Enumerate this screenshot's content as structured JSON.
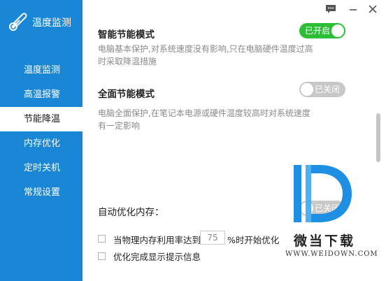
{
  "app": {
    "title": "温度监测"
  },
  "sidebar": {
    "items": [
      {
        "label": "温度监测"
      },
      {
        "label": "高温报警"
      },
      {
        "label": "节能降温"
      },
      {
        "label": "内存优化"
      },
      {
        "label": "定时关机"
      },
      {
        "label": "常规设置"
      }
    ],
    "active_index": 2
  },
  "sections": {
    "smart": {
      "title": "智能节能模式",
      "desc_line1": "电脑基本保护,对系统速度没有影响,只在电脑硬件温度过高",
      "desc_line2": "时采取降温措施",
      "toggle_label": "已开启",
      "toggle_on": true
    },
    "full": {
      "title": "全面节能模式",
      "desc_line1": "电脑全面保护,在笔记本电源或硬件温度较高时对系统速度",
      "desc_line2": "有一定影响",
      "toggle_label": "已关闭",
      "toggle_on": false
    },
    "memory": {
      "title": "自动优化内存：",
      "toggle_label": "已关闭",
      "toggle_on": false,
      "option1_prefix": "当物理内存利用率达到",
      "option1_value": "75",
      "option1_suffix": "%时开始优化",
      "option2_label": "优化完成显示提示信息"
    }
  },
  "watermark": {
    "title": "微当下载",
    "url": "WWW.WEIDOWN.COM"
  },
  "colors": {
    "sidebar": "#1a86d6",
    "toggle_on": "#2cbf35",
    "toggle_off": "#c8c8c8"
  }
}
